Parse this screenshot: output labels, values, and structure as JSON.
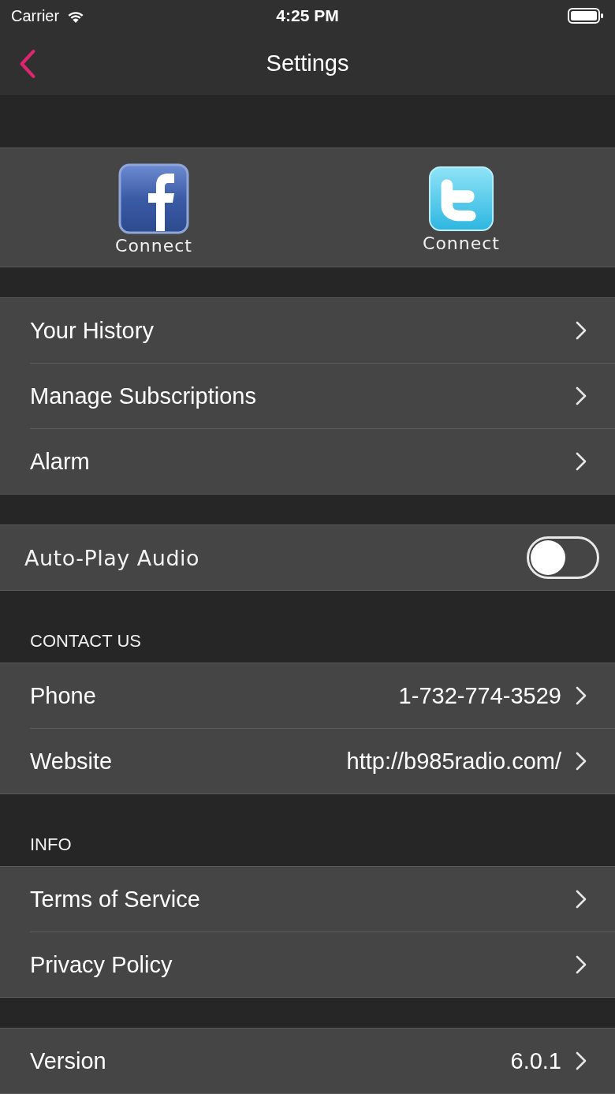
{
  "status_bar": {
    "carrier": "Carrier",
    "time": "4:25 PM"
  },
  "nav": {
    "title": "Settings"
  },
  "social": [
    {
      "kind": "facebook",
      "label": "Connect"
    },
    {
      "kind": "twitter",
      "label": "Connect"
    }
  ],
  "sections": [
    {
      "rows": [
        {
          "kind": "link",
          "label": "Your History"
        },
        {
          "kind": "link",
          "label": "Manage Subscriptions"
        },
        {
          "kind": "link",
          "label": "Alarm"
        }
      ]
    },
    {
      "rows": [
        {
          "kind": "toggle",
          "label": "Auto-Play Audio",
          "on": false
        }
      ]
    },
    {
      "header": "CONTACT US",
      "rows": [
        {
          "kind": "link",
          "label": "Phone",
          "value": "1-732-774-3529"
        },
        {
          "kind": "link",
          "label": "Website",
          "value": "http://b985radio.com/"
        }
      ]
    },
    {
      "header": "INFO",
      "rows": [
        {
          "kind": "link",
          "label": "Terms of Service"
        },
        {
          "kind": "link",
          "label": "Privacy Policy"
        }
      ]
    },
    {
      "rows": [
        {
          "kind": "link",
          "label": "Version",
          "value": "6.0.1"
        }
      ]
    }
  ]
}
